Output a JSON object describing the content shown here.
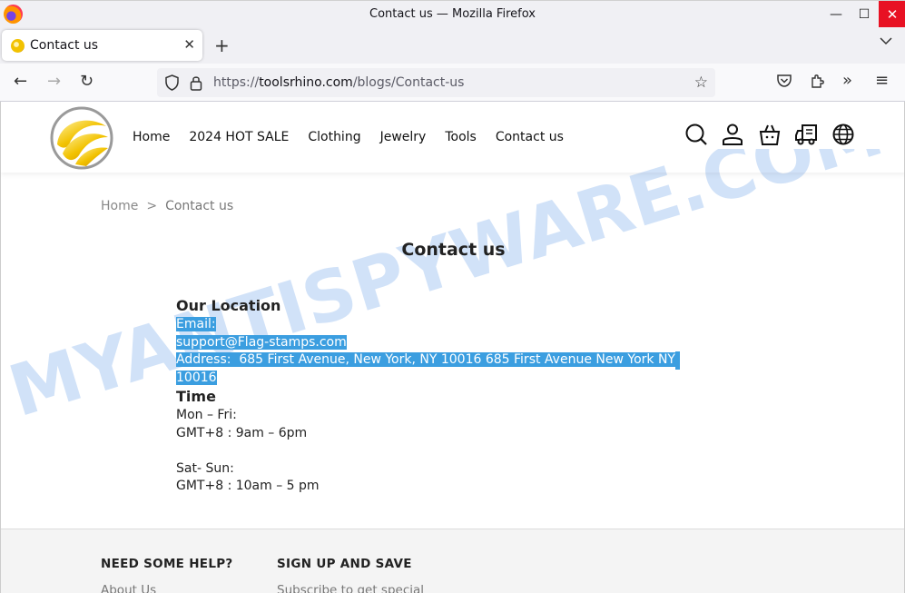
{
  "window": {
    "title": "Contact us — Mozilla Firefox",
    "minimize_glyph": "—",
    "maximize_glyph": "☐",
    "close_glyph": "✕"
  },
  "tab": {
    "label": "Contact us",
    "close_glyph": "✕",
    "new_tab_glyph": "+",
    "list_glyph": "⌄"
  },
  "navbar": {
    "back_glyph": "←",
    "forward_glyph": "→",
    "reload_glyph": "↻",
    "url_protocol": "https://",
    "url_domain": "toolsrhino.com",
    "url_path": "/blogs/Contact-us",
    "star_glyph": "☆",
    "pocket_glyph": "♡",
    "extensions_glyph": "⧉",
    "more_tools_glyph": "»",
    "menu_glyph": "≡"
  },
  "header": {
    "menu": [
      "Home",
      "2024 HOT SALE",
      "Clothing",
      "Jewelry",
      "Tools",
      "Contact us"
    ],
    "icons": [
      "search-icon",
      "account-icon",
      "cart-icon",
      "shipping-truck-icon",
      "language-globe-icon"
    ]
  },
  "breadcrumb": {
    "home": "Home",
    "separator": ">",
    "current": "Contact us"
  },
  "page_title": "Contact us",
  "contact": {
    "location_heading": "Our Location",
    "email_label": "Email:",
    "email": "support@Flag-stamps.com",
    "address_line1": "Address:  685 First Avenue, New York, NY 10016 685 First Avenue New York NY",
    "address_line2": "10016",
    "time_heading": "Time",
    "weekday_label": "Mon – Fri:",
    "weekday_hours": "GMT+8 : 9am – 6pm",
    "weekend_label": "Sat- Sun:",
    "weekend_hours": "GMT+8 : 10am – 5 pm"
  },
  "watermark": "MYANTISPYWARE.COM",
  "footer": {
    "help_heading": "NEED SOME HELP?",
    "help_link": "About Us",
    "signup_heading": "SIGN UP AND SAVE",
    "signup_text": "Subscribe to get special"
  },
  "colors": {
    "selection": "#3b9ee0",
    "close_button": "#e81123",
    "watermark": "#2f7de0",
    "logo_gold": "#f2c200"
  }
}
